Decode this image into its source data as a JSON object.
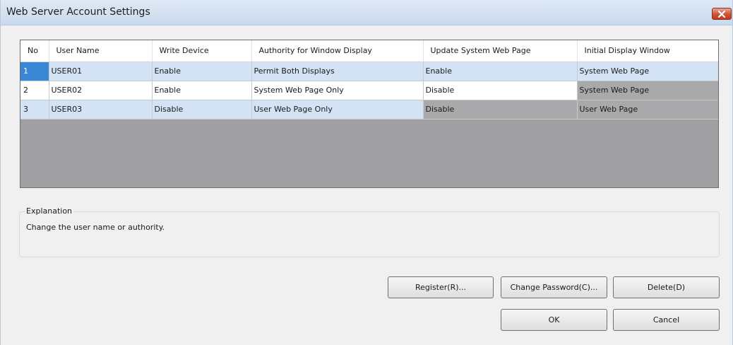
{
  "window": {
    "title": "Web Server Account Settings"
  },
  "table": {
    "headers": [
      "No",
      "User Name",
      "Write Device",
      "Authority for Window Display",
      "Update System Web Page",
      "Initial Display Window"
    ],
    "rows": [
      [
        "1",
        "USER01",
        "Enable",
        "Permit Both Displays",
        "Enable",
        "System Web Page"
      ],
      [
        "2",
        "USER02",
        "Enable",
        "System Web Page Only",
        "Disable",
        "System Web Page"
      ],
      [
        "3",
        "USER03",
        "Disable",
        "User Web Page Only",
        "Disable",
        "User Web Page"
      ]
    ],
    "selected_row": "1"
  },
  "explanation": {
    "legend": "Explanation",
    "text": "Change the user name or authority."
  },
  "buttons": {
    "register": "Register(R)...",
    "change_password": "Change Password(C)...",
    "delete": "Delete(D)",
    "ok": "OK",
    "cancel": "Cancel"
  },
  "colors": {
    "row_highlight": "#d3e3f5",
    "selected_cell": "#3a87d6",
    "disabled_cell": "#a9a9ac",
    "grid_background": "#a0a0a3",
    "close_button": "#cf5234"
  }
}
